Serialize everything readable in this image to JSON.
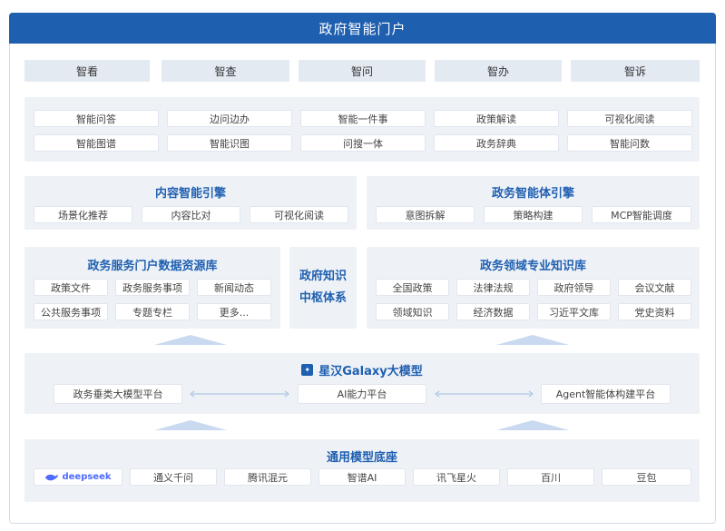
{
  "header": {
    "title": "政府智能门户"
  },
  "top_tabs": [
    "智看",
    "智查",
    "智问",
    "智办",
    "智诉"
  ],
  "features": {
    "row1": [
      "智能问答",
      "边问边办",
      "智能一件事",
      "政策解读",
      "可视化阅读"
    ],
    "row2": [
      "智能图谱",
      "智能识图",
      "问搜一体",
      "政务辞典",
      "智能问数"
    ]
  },
  "content_engine": {
    "title": "内容智能引擎",
    "items": [
      "场景化推荐",
      "内容比对",
      "可视化阅读"
    ]
  },
  "agent_engine": {
    "title": "政务智能体引擎",
    "items": [
      "意图拆解",
      "策略构建",
      "MCP智能调度"
    ]
  },
  "portal_db": {
    "title": "政务服务门户数据资源库",
    "row1": [
      "政策文件",
      "政务服务事项",
      "新闻动态"
    ],
    "row2": [
      "公共服务事项",
      "专题专栏",
      "更多..."
    ]
  },
  "hub": {
    "line1": "政府知识",
    "line2": "中枢体系"
  },
  "domain_kb": {
    "title": "政务领域专业知识库",
    "row1": [
      "全国政策",
      "法律法规",
      "政府领导",
      "会议文献"
    ],
    "row2": [
      "领域知识",
      "经济数据",
      "习近平文库",
      "党史资料"
    ]
  },
  "galaxy": {
    "title": "星汉Galaxy大模型",
    "items": [
      "政务垂类大模型平台",
      "AI能力平台",
      "Agent智能体构建平台"
    ]
  },
  "base": {
    "title": "通用模型底座",
    "deepseek": "deepseek",
    "items": [
      "通义千问",
      "腾讯混元",
      "智谱AI",
      "讯飞星火",
      "百川",
      "豆包"
    ]
  },
  "colors": {
    "brand": "#1f5fb0",
    "panel": "#eef2f7",
    "tab": "#e4eaf2",
    "arrow": "#9db9df"
  }
}
